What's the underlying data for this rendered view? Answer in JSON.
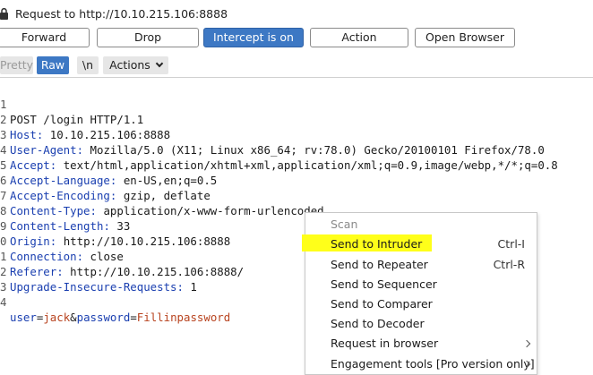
{
  "request_header": {
    "title": "Request to http://10.10.215.106:8888"
  },
  "action_buttons": {
    "forward": "Forward",
    "drop": "Drop",
    "intercept": "Intercept is on",
    "action": "Action",
    "open_browser": "Open Browser"
  },
  "editor_toolbar": {
    "pretty": "Pretty",
    "raw": "Raw",
    "newline": "\\n",
    "actions": "Actions"
  },
  "editor": {
    "gutter": [
      "1",
      "2",
      "3",
      "4",
      "5",
      "6",
      "7",
      "8",
      "9",
      "0",
      "1",
      "2",
      "3",
      "4"
    ],
    "request_line": "POST /login HTTP/1.1",
    "headers": [
      {
        "name": "Host",
        "value": "10.10.215.106:8888"
      },
      {
        "name": "User-Agent",
        "value": "Mozilla/5.0 (X11; Linux x86_64; rv:78.0) Gecko/20100101 Firefox/78.0"
      },
      {
        "name": "Accept",
        "value": "text/html,application/xhtml+xml,application/xml;q=0.9,image/webp,*/*;q=0.8"
      },
      {
        "name": "Accept-Language",
        "value": "en-US,en;q=0.5"
      },
      {
        "name": "Accept-Encoding",
        "value": "gzip, deflate"
      },
      {
        "name": "Content-Type",
        "value": "application/x-www-form-urlencoded"
      },
      {
        "name": "Content-Length",
        "value": "33"
      },
      {
        "name": "Origin",
        "value": "http://10.10.215.106:8888"
      },
      {
        "name": "Connection",
        "value": "close"
      },
      {
        "name": "Referer",
        "value": "http://10.10.215.106:8888/"
      },
      {
        "name": "Upgrade-Insecure-Requests",
        "value": "1"
      }
    ],
    "body_params": [
      {
        "name": "user",
        "value": "jack"
      },
      {
        "name": "password",
        "value": "Fillinpassword"
      }
    ]
  },
  "context_menu": {
    "items": [
      {
        "label": "Scan",
        "shortcut": "",
        "disabled": true
      },
      {
        "label": "Send to Intruder",
        "shortcut": "Ctrl-I"
      },
      {
        "label": "Send to Repeater",
        "shortcut": "Ctrl-R"
      },
      {
        "label": "Send to Sequencer",
        "shortcut": ""
      },
      {
        "label": "Send to Comparer",
        "shortcut": ""
      },
      {
        "label": "Send to Decoder",
        "shortcut": ""
      },
      {
        "label": "Request in browser",
        "shortcut": ""
      },
      {
        "label": "Engagement tools [Pro version only]",
        "shortcut": ""
      }
    ]
  },
  "colors": {
    "accent": "#3d78c4",
    "header_key": "#1a3fb0",
    "param_value": "#b8431f",
    "annotation_highlight": "#ffff1a"
  }
}
